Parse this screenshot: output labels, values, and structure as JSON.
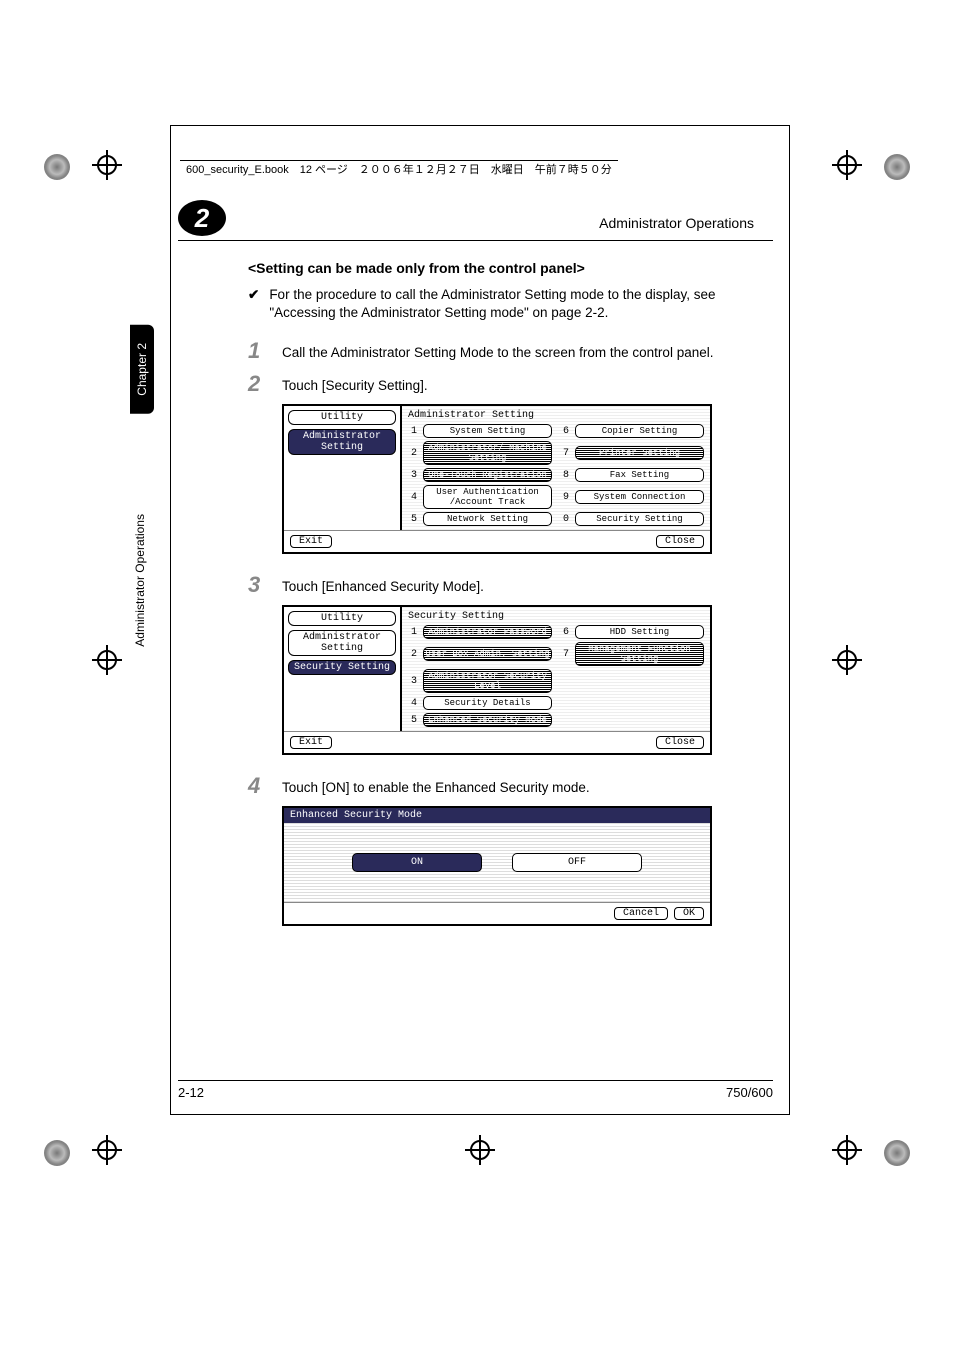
{
  "meta": {
    "book_header": "600_security_E.book　12 ページ　２００６年１２月２７日　水曜日　午前７時５０分",
    "running_head": "Administrator Operations",
    "chapter_num": "2",
    "side_tab_chapter": "Chapter 2",
    "side_tab_section": "Administrator Operations",
    "page_num": "2-12",
    "model": "750/600"
  },
  "heading": "<Setting can be made only from the control panel>",
  "check_text": "For the procedure to call the Administrator Setting mode to the display, see \"Accessing the Administrator Setting mode\" on page 2-2.",
  "check_mark": "✔",
  "steps": {
    "s1": {
      "n": "1",
      "t": "Call the Administrator Setting Mode to the screen from the control panel."
    },
    "s2": {
      "n": "2",
      "t": "Touch [Security Setting]."
    },
    "s3": {
      "n": "3",
      "t": "Touch [Enhanced Security Mode]."
    },
    "s4": {
      "n": "4",
      "t": "Touch [ON] to enable the Enhanced Security mode."
    }
  },
  "panel1": {
    "left_utility": "Utility",
    "left_admin": "Administrator Setting",
    "title": "Administrator Setting",
    "items": [
      {
        "n": "1",
        "l": "System Setting"
      },
      {
        "n": "2",
        "l": "Administrator/ Machine Setting"
      },
      {
        "n": "3",
        "l": "One-Touch Registration"
      },
      {
        "n": "4",
        "l": "User Authentication /Account Track"
      },
      {
        "n": "5",
        "l": "Network Setting"
      },
      {
        "n": "6",
        "l": "Copier Setting"
      },
      {
        "n": "7",
        "l": "Printer Setting"
      },
      {
        "n": "8",
        "l": "Fax Setting"
      },
      {
        "n": "9",
        "l": "System Connection"
      },
      {
        "n": "0",
        "l": "Security Setting"
      }
    ],
    "exit": "Exit",
    "close": "Close"
  },
  "panel2": {
    "left_utility": "Utility",
    "left_admin": "Administrator Setting",
    "left_sec": "Security Setting",
    "title": "Security Setting",
    "items": [
      {
        "n": "1",
        "l": "Administrator Password"
      },
      {
        "n": "2",
        "l": "User Box Admin. Setting"
      },
      {
        "n": "3",
        "l": "Administrator Security Level"
      },
      {
        "n": "4",
        "l": "Security Details"
      },
      {
        "n": "5",
        "l": "Enhanced Security Mode"
      },
      {
        "n": "6",
        "l": "HDD Setting"
      },
      {
        "n": "7",
        "l": "Management Function Setting"
      }
    ],
    "exit": "Exit",
    "close": "Close"
  },
  "panel3": {
    "title": "Enhanced Security Mode",
    "on": "ON",
    "off": "OFF",
    "cancel": "Cancel",
    "ok": "OK"
  }
}
